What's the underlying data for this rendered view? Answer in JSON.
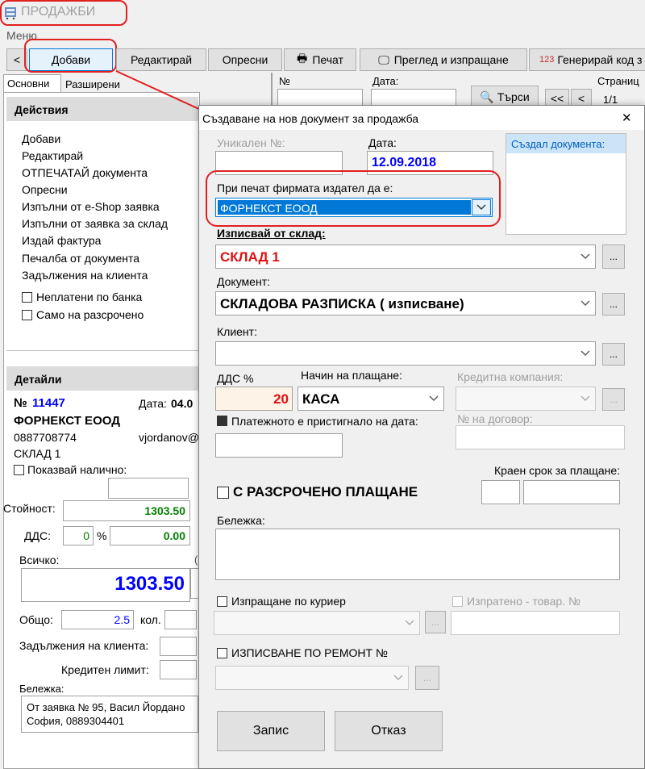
{
  "app": {
    "title": "ПРОДАЖБИ",
    "menu": "Меню"
  },
  "toolbar": {
    "back": "<",
    "add": "Добави",
    "edit": "Редактирай",
    "refresh": "Опресни",
    "print": "Печат",
    "preview_send": "Преглед и изпращане",
    "gen_code": "Генерирай код з",
    "gen_code_icon_text": "123"
  },
  "tabs": {
    "basic": "Основни",
    "extended": "Разширени"
  },
  "filter": {
    "number_label": "№",
    "date_label": "Дата:",
    "search": "Търси",
    "first": "<<",
    "prev": "<",
    "pages_label": "Страниц",
    "pages_value": "1/1"
  },
  "actions": {
    "header": "Действия",
    "items": [
      "Добави",
      "Редактирай",
      "ОТПЕЧАТАЙ документа",
      "Опресни",
      "Изпълни от e-Shop заявка",
      "Изпълни от заявка за склад",
      "Издай фактура",
      "Печалба от документа",
      "Задължения на клиента"
    ],
    "unpaid_bank": "Неплатени по банка",
    "installments_only": "Само на разсрочено"
  },
  "details": {
    "header": "Детайли",
    "number_label": "№",
    "number": "11447",
    "date_label": "Дата:",
    "date_value": "04.0",
    "company": "ФОРНЕКСТ ЕООД",
    "phone": "0887708774",
    "user": "vjordanov@",
    "warehouse": "СКЛАД 1",
    "show_available": "Показвай налично:",
    "value_label": "Стойност:",
    "value": "1303.50",
    "vat_label": "ДДС:",
    "vat_pct": "0",
    "pct_sign": "%",
    "vat_value": "0.00",
    "total_label": "Всичко:",
    "total": "1303.50",
    "general_label": "Общо:",
    "qty": "2.5",
    "qty_unit": "кол.",
    "client_debts": "Задължения на клиента:",
    "credit_limit": "Кредитен лимит:",
    "note_label": "Бележка:",
    "note_line1": "От заявка № 95, Васил Йордано",
    "note_line2": "София, 0889304401"
  },
  "dialog": {
    "title": "Създаване на нов документ за продажба",
    "close": "✕",
    "unique_no_label": "Уникален №:",
    "date_label": "Дата:",
    "date_value": "12.09.2018",
    "created_by_label": "Създал документа:",
    "print_company_label": "При печат фирмата издател да е:",
    "print_company_value": "ФОРНЕКСТ ЕООД",
    "warehouse_label": "Изписвай от склад:",
    "warehouse_value": "СКЛАД 1",
    "document_label": "Документ:",
    "document_value": "СКЛАДОВА РАЗПИСКА ( изписване)",
    "client_label": "Клиент:",
    "vat_label": "ДДС %",
    "vat_value": "20",
    "payment_label": "Начин на плащане:",
    "payment_value": "КАСА",
    "credit_company_label": "Кредитна компания:",
    "payment_arrived_label": "Платежното е пристигнало на дата:",
    "contract_label": "№ на договор:",
    "due_label": "Краен срок за плащане:",
    "installments_label": "С РАЗСРОЧЕНО ПЛАЩАНЕ",
    "note_label": "Бележка:",
    "courier_label": "Изпращане по куриер",
    "shipped_label": "Изпратено - товар. №",
    "repair_label": "ИЗПИСВАНЕ ПО РЕМОНТ №",
    "save": "Запис",
    "cancel": "Отказ",
    "ellipsis": "..."
  },
  "colors": {
    "accent_blue": "#0000ff",
    "red": "#e01010",
    "green": "#008000",
    "annotation": "#e02020",
    "selection": "#0078d7"
  }
}
